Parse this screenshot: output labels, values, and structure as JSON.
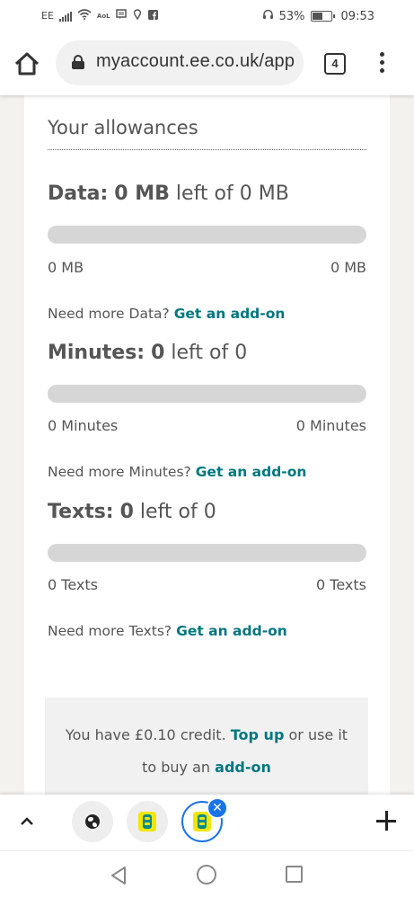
{
  "status_bar": {
    "carrier": "EE",
    "aol_label": "AoL",
    "battery_percent": "53%",
    "time": "09:53"
  },
  "browser": {
    "url": "myaccount.ee.co.uk/app",
    "tab_count": "4"
  },
  "allowances": {
    "heading": "Your allowances",
    "blocks": [
      {
        "title_bold": "Data:",
        "title_value": "0 MB",
        "title_rest": "left of 0 MB",
        "used_fraction": 0,
        "label_left": "0 MB",
        "label_right": "0 MB",
        "more_prefix": "Need more Data?",
        "more_link": "Get an add-on"
      },
      {
        "title_bold": "Minutes:",
        "title_value": "0",
        "title_rest": "left of 0",
        "used_fraction": 0,
        "label_left": "0 Minutes",
        "label_right": "0 Minutes",
        "more_prefix": "Need more Minutes?",
        "more_link": "Get an add-on"
      },
      {
        "title_bold": "Texts:",
        "title_value": "0",
        "title_rest": "left of 0",
        "used_fraction": 0,
        "label_left": "0 Texts",
        "label_right": "0 Texts",
        "more_prefix": "Need more Texts?",
        "more_link": "Get an add-on"
      }
    ]
  },
  "credit": {
    "prefix": "You have £0.10 credit.",
    "topup_link": "Top up",
    "middle": "or use it",
    "line2_prefix": "to buy an",
    "addon_link": "add-on"
  },
  "colors": {
    "link": "#00777f",
    "bar_track": "#d6d6d6",
    "active_tab": "#1a73e8",
    "ee_yellow": "#f4e500",
    "ee_teal": "#008c8c"
  }
}
